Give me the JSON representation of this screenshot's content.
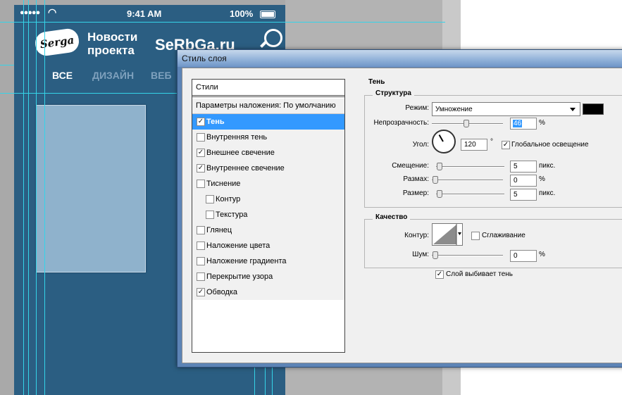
{
  "phone": {
    "status_dots": "●●●●●",
    "time": "9:41 AM",
    "battery": "100%",
    "logo": "Serga",
    "news_line1": "Новости",
    "news_line2": "проекта",
    "site": "SeRbGa.ru",
    "nav": [
      "ВСЕ",
      "ДИЗАЙН",
      "ВЕБ"
    ]
  },
  "dialog": {
    "title": "Стиль слоя",
    "styles_header": "Стили",
    "blend_options": "Параметры наложения: По умолчанию",
    "styles": [
      {
        "label": "Тень",
        "checked": true,
        "selected": true
      },
      {
        "label": "Внутренняя тень",
        "checked": false
      },
      {
        "label": "Внешнее свечение",
        "checked": true
      },
      {
        "label": "Внутреннее свечение",
        "checked": true
      },
      {
        "label": "Тиснение",
        "checked": false
      },
      {
        "label": "Контур",
        "checked": false,
        "indent": true
      },
      {
        "label": "Текстура",
        "checked": false,
        "indent": true
      },
      {
        "label": "Глянец",
        "checked": false
      },
      {
        "label": "Наложение цвета",
        "checked": false
      },
      {
        "label": "Наложение градиента",
        "checked": false
      },
      {
        "label": "Перекрытие узора",
        "checked": false
      },
      {
        "label": "Обводка",
        "checked": true
      }
    ],
    "shadow": {
      "section": "Тень",
      "structure": "Структура",
      "mode_label": "Режим:",
      "mode_value": "Умножение",
      "mode_color": "#000000",
      "opacity_label": "Непрозрачность:",
      "opacity_value": "46",
      "opacity_unit": "%",
      "angle_label": "Угол:",
      "angle_value": "120",
      "angle_unit": "°",
      "global_light_label": "Глобальное освещение",
      "global_light_checked": true,
      "distance_label": "Смещение:",
      "distance_value": "5",
      "distance_unit": "пикс.",
      "spread_label": "Размах:",
      "spread_value": "0",
      "spread_unit": "%",
      "size_label": "Размер:",
      "size_value": "5",
      "size_unit": "пикс."
    },
    "quality": {
      "section": "Качество",
      "contour_label": "Контур:",
      "antialias_label": "Сглаживание",
      "antialias_checked": false,
      "noise_label": "Шум:",
      "noise_value": "0",
      "noise_unit": "%",
      "knockout_label": "Слой выбивает тень",
      "knockout_checked": true
    }
  }
}
